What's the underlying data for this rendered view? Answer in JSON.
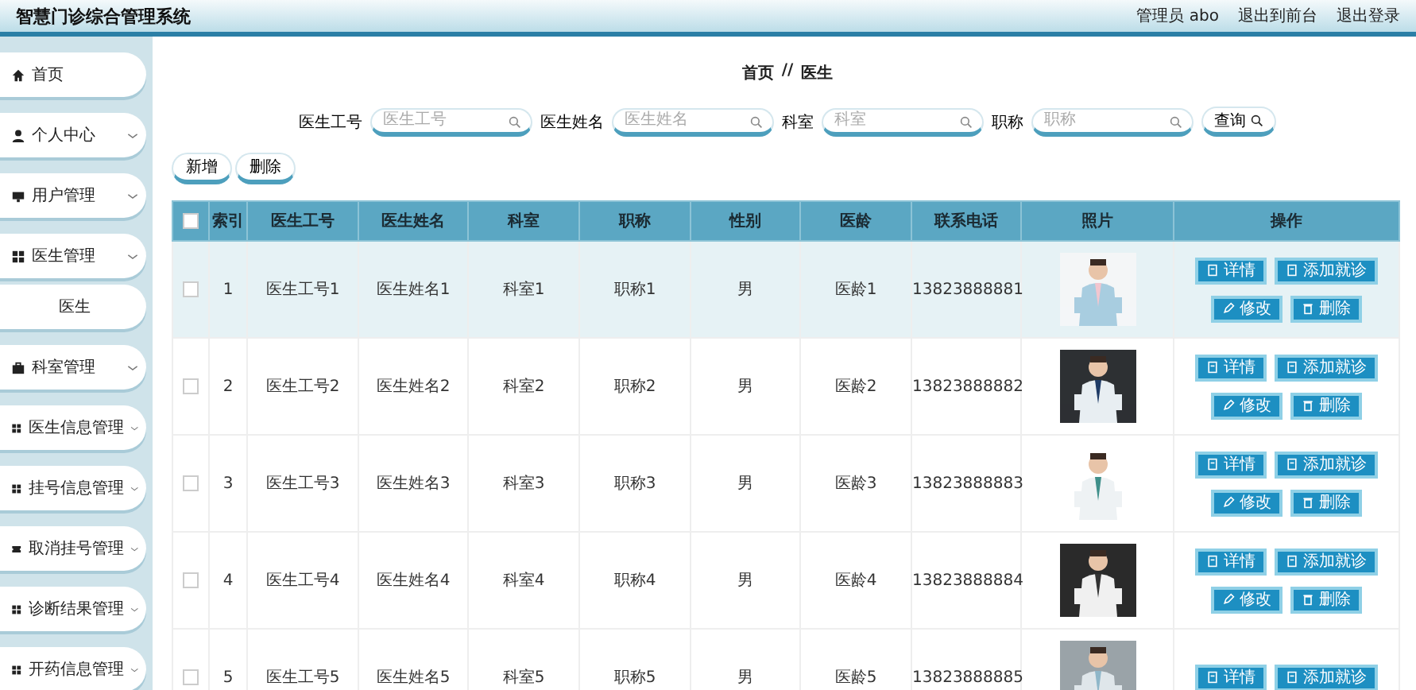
{
  "header": {
    "title": "智慧门诊综合管理系统",
    "user": "管理员 abo",
    "links": [
      "退出到前台",
      "退出登录"
    ]
  },
  "sidebar": {
    "items": [
      {
        "label": "首页",
        "chevron": false
      },
      {
        "label": "个人中心",
        "chevron": true
      },
      {
        "label": "用户管理",
        "chevron": true
      },
      {
        "label": "医生管理",
        "chevron": true,
        "children": [
          {
            "label": "医生"
          }
        ]
      },
      {
        "label": "科室管理",
        "chevron": true
      },
      {
        "label": "医生信息管理",
        "chevron": true
      },
      {
        "label": "挂号信息管理",
        "chevron": true
      },
      {
        "label": "取消挂号管理",
        "chevron": true
      },
      {
        "label": "诊断结果管理",
        "chevron": true
      },
      {
        "label": "开药信息管理",
        "chevron": true
      }
    ]
  },
  "breadcrumb": [
    "首页",
    "//",
    "医生"
  ],
  "search": {
    "fields": [
      {
        "label": "医生工号",
        "placeholder": "医生工号"
      },
      {
        "label": "医生姓名",
        "placeholder": "医生姓名"
      },
      {
        "label": "科室",
        "placeholder": "科室"
      },
      {
        "label": "职称",
        "placeholder": "职称"
      }
    ],
    "button": "查询"
  },
  "toolbar": [
    "新增",
    "删除"
  ],
  "table": {
    "header_checkbox": {
      "checked": false
    },
    "columns": [
      "索引",
      "医生工号",
      "医生姓名",
      "科室",
      "职称",
      "性别",
      "医龄",
      "联系电话",
      "照片",
      "操作"
    ],
    "rows": [
      {
        "checked": false,
        "highlighted": true,
        "cells": [
          "1",
          "医生工号1",
          "医生姓名1",
          "科室1",
          "职称1",
          "男",
          "医龄1",
          "13823888881"
        ],
        "photo": {
          "kind": "picture"
        },
        "actions": [
          {
            "label": "详情",
            "kind": "doc"
          },
          {
            "label": "添加就诊",
            "kind": "doc"
          },
          {
            "label": "修改",
            "kind": "edit"
          },
          {
            "label": "删除",
            "kind": "trash"
          }
        ]
      },
      {
        "checked": false,
        "highlighted": false,
        "cells": [
          "2",
          "医生工号2",
          "医生姓名2",
          "科室2",
          "职称2",
          "男",
          "医龄2",
          "13823888882"
        ],
        "photo": {
          "kind": "picture"
        },
        "actions": [
          {
            "label": "详情",
            "kind": "doc"
          },
          {
            "label": "添加就诊",
            "kind": "doc"
          },
          {
            "label": "修改",
            "kind": "edit"
          },
          {
            "label": "删除",
            "kind": "trash"
          }
        ]
      },
      {
        "checked": false,
        "highlighted": false,
        "cells": [
          "3",
          "医生工号3",
          "医生姓名3",
          "科室3",
          "职称3",
          "男",
          "医龄3",
          "13823888883"
        ],
        "photo": {
          "kind": "picture"
        },
        "actions": [
          {
            "label": "详情",
            "kind": "doc"
          },
          {
            "label": "添加就诊",
            "kind": "doc"
          },
          {
            "label": "修改",
            "kind": "edit"
          },
          {
            "label": "删除",
            "kind": "trash"
          }
        ]
      },
      {
        "checked": false,
        "highlighted": false,
        "cells": [
          "4",
          "医生工号4",
          "医生姓名4",
          "科室4",
          "职称4",
          "男",
          "医龄4",
          "13823888884"
        ],
        "photo": {
          "kind": "picture"
        },
        "actions": [
          {
            "label": "详情",
            "kind": "doc"
          },
          {
            "label": "添加就诊",
            "kind": "doc"
          },
          {
            "label": "修改",
            "kind": "edit"
          },
          {
            "label": "删除",
            "kind": "trash"
          }
        ]
      },
      {
        "checked": false,
        "highlighted": false,
        "cells": [
          "5",
          "医生工号5",
          "医生姓名5",
          "科室5",
          "职称5",
          "男",
          "医龄5",
          "13823888885"
        ],
        "photo": {
          "kind": "picture"
        },
        "actions": [
          {
            "label": "详情",
            "kind": "doc"
          },
          {
            "label": "添加就诊",
            "kind": "doc"
          }
        ]
      }
    ]
  }
}
